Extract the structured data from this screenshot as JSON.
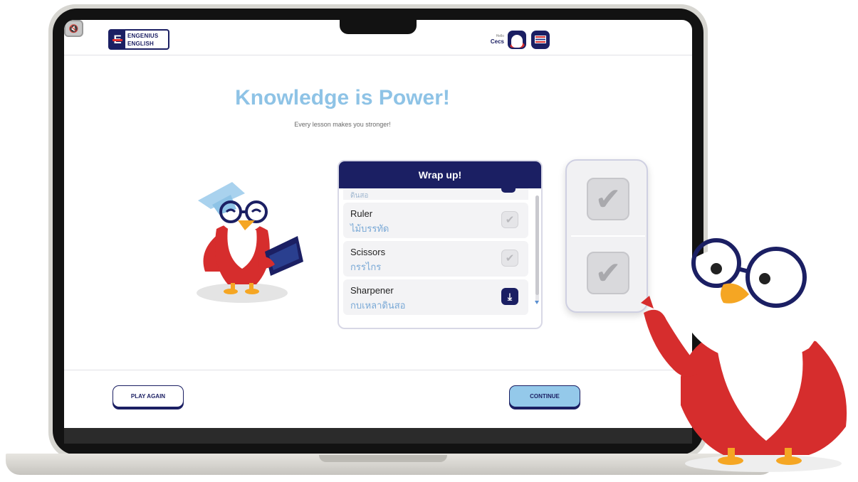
{
  "header": {
    "logo_line1": "ENGENIUS",
    "logo_line2": "ENGLISH",
    "hello_label": "Hello",
    "user_name": "Cecs"
  },
  "main": {
    "title": "Knowledge is Power!",
    "subtitle": "Every lesson makes you stronger!"
  },
  "wrap_up": {
    "heading": "Wrap up!",
    "peek_thai": "ดินสอ",
    "items": [
      {
        "english": "Ruler",
        "thai": "ไม้บรรทัด",
        "state": "checked"
      },
      {
        "english": "Scissors",
        "thai": "กรรไกร",
        "state": "checked"
      },
      {
        "english": "Sharpener",
        "thai": "กบเหลาดินสอ",
        "state": "download"
      }
    ]
  },
  "footer": {
    "play_again_label": "PLAY AGAIN",
    "continue_label": "CONTINUE"
  },
  "icons": {
    "check": "✔",
    "download": "⤓",
    "mute": "🔇"
  },
  "colors": {
    "brand_navy": "#1b1f63",
    "title_blue": "#8ec3e6",
    "continue_fill": "#94c9ea",
    "mascot_red": "#d62d2d"
  }
}
